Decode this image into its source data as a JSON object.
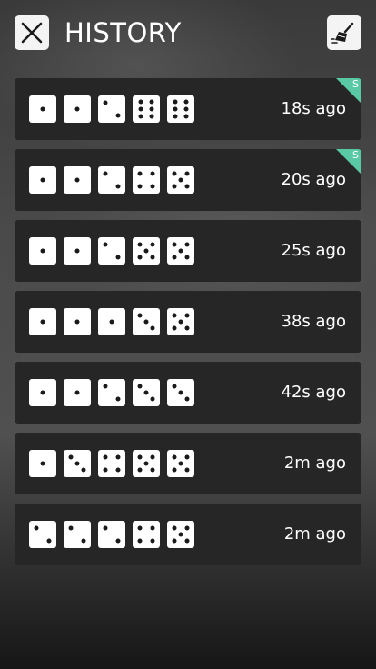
{
  "header": {
    "title": "HISTORY",
    "close_icon": "close-x-icon",
    "clear_icon": "broom-sweep-icon"
  },
  "colors": {
    "row_bg": "#262626",
    "die_face": "#ffffff",
    "pip": "#1a1a1a",
    "badge": "#59c9a5"
  },
  "history": [
    {
      "dice": [
        1,
        1,
        2,
        6,
        6
      ],
      "time": "18s ago",
      "badge": "S"
    },
    {
      "dice": [
        1,
        1,
        2,
        4,
        5
      ],
      "time": "20s ago",
      "badge": "S"
    },
    {
      "dice": [
        1,
        1,
        2,
        5,
        5
      ],
      "time": "25s ago"
    },
    {
      "dice": [
        1,
        1,
        1,
        3,
        5
      ],
      "time": "38s ago"
    },
    {
      "dice": [
        1,
        1,
        2,
        3,
        3
      ],
      "time": "42s ago"
    },
    {
      "dice": [
        1,
        3,
        4,
        5,
        5
      ],
      "time": "2m ago"
    },
    {
      "dice": [
        2,
        2,
        2,
        4,
        5
      ],
      "time": "2m ago"
    }
  ]
}
